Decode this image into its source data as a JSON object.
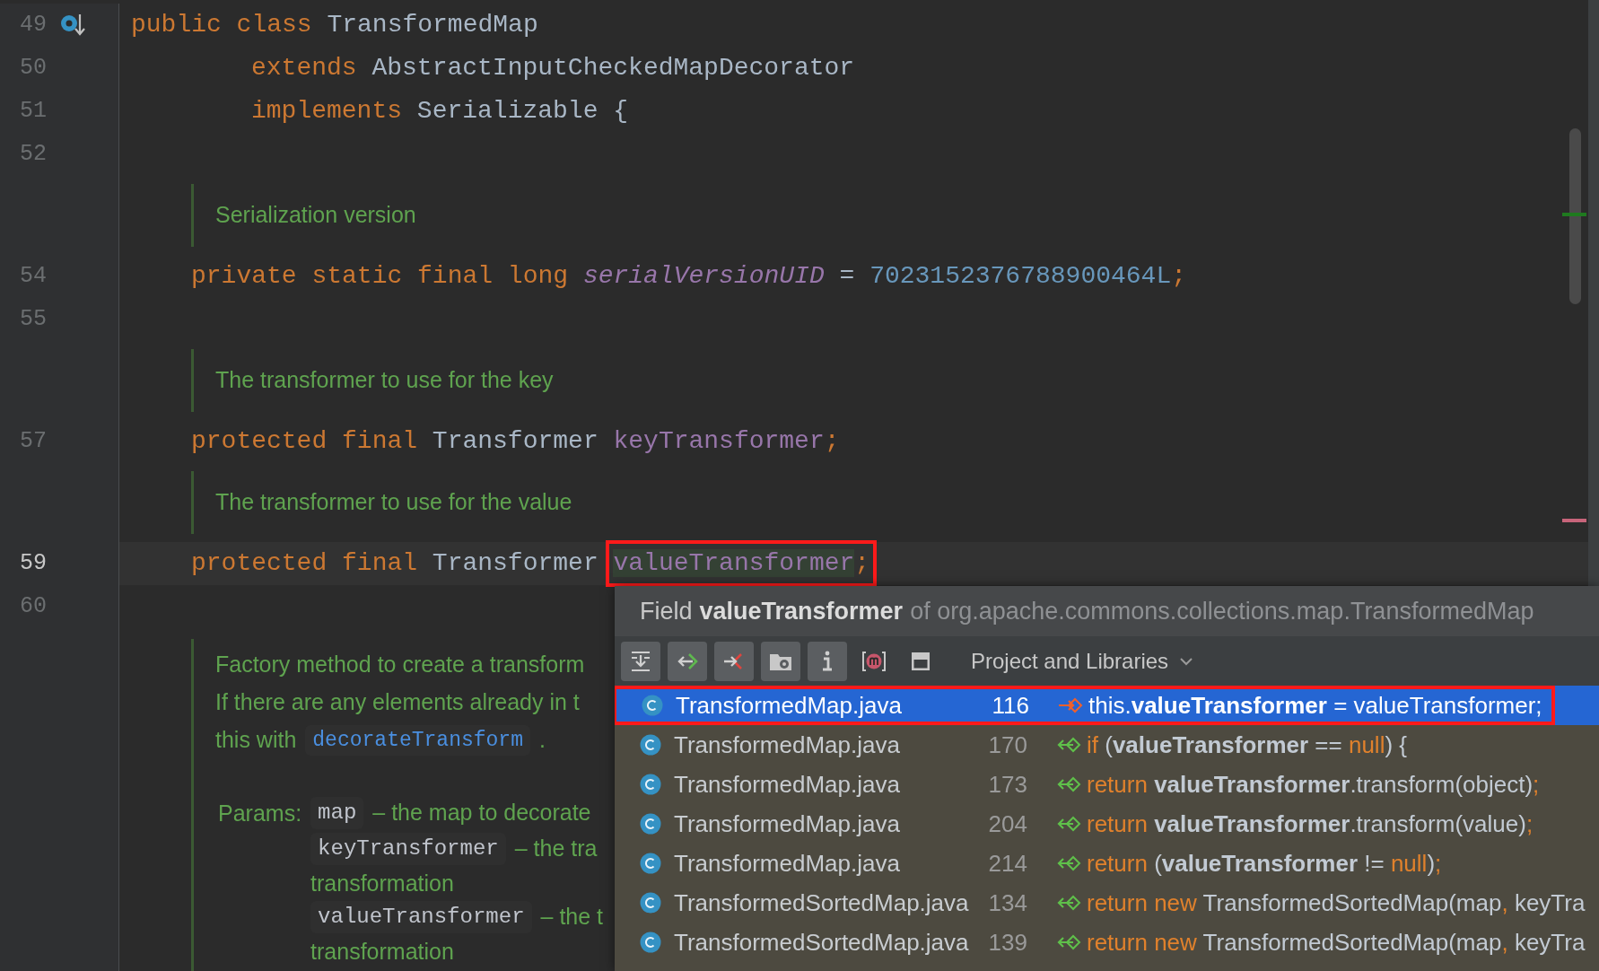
{
  "editor": {
    "lines": [
      {
        "kind": "code",
        "number": "49",
        "current": false,
        "has_implementations": true,
        "tokens": [
          {
            "text": "public class",
            "kind": "keyword"
          },
          {
            "text": " TransformedMap",
            "kind": "plain"
          }
        ]
      },
      {
        "kind": "continuation",
        "number": "50",
        "current": false,
        "tokens": [
          {
            "text": "extends",
            "kind": "keyword"
          },
          {
            "text": " AbstractInputCheckedMapDecorator",
            "kind": "plain"
          }
        ]
      },
      {
        "kind": "continuation",
        "number": "51",
        "current": false,
        "tokens": [
          {
            "text": "implements",
            "kind": "keyword"
          },
          {
            "text": " Serializable {",
            "kind": "plain"
          }
        ]
      },
      {
        "kind": "code",
        "number": "52",
        "current": false
      },
      {
        "kind": "doc",
        "paragraphs": [
          [
            {
              "text": "Serialization version",
              "kind": "text"
            }
          ]
        ]
      },
      {
        "kind": "member",
        "number": "54",
        "current": false,
        "tokens": [
          {
            "text": "private static final long ",
            "kind": "keyword"
          },
          {
            "text": "serialVersionUID",
            "kind": "static_field"
          },
          {
            "text": " = ",
            "kind": "plain"
          },
          {
            "text": "7023152376788900464L",
            "kind": "number"
          },
          {
            "text": ";",
            "kind": "keyword"
          }
        ]
      },
      {
        "kind": "code",
        "number": "55",
        "current": false
      },
      {
        "kind": "doc",
        "paragraphs": [
          [
            {
              "text": "The transformer to use for the key",
              "kind": "text"
            }
          ]
        ]
      },
      {
        "kind": "member",
        "number": "57",
        "current": false,
        "tokens": [
          {
            "text": "protected final",
            "kind": "keyword"
          },
          {
            "text": " Transformer ",
            "kind": "plain"
          },
          {
            "text": "keyTransformer",
            "kind": "field"
          },
          {
            "text": ";",
            "kind": "keyword"
          }
        ]
      },
      {
        "kind": "doc",
        "paragraphs": [
          [
            {
              "text": "The transformer to use for the value",
              "kind": "text"
            }
          ]
        ]
      },
      {
        "kind": "member",
        "number": "59",
        "current": true,
        "tokens": [
          {
            "text": "protected final",
            "kind": "keyword"
          },
          {
            "text": " Transformer ",
            "kind": "plain"
          },
          {
            "text": "valueTransformer",
            "kind": "field",
            "highlighted": true,
            "outlined": true
          },
          {
            "text": ";",
            "kind": "keyword",
            "outlined": true
          }
        ]
      },
      {
        "kind": "code",
        "number": "60",
        "current": false
      },
      {
        "kind": "doc",
        "paragraphs": [
          [
            {
              "text": "Factory method to create a transform",
              "kind": "text"
            }
          ],
          [
            {
              "text": "If there are any elements already in t",
              "kind": "text"
            }
          ],
          [
            {
              "text": "this with",
              "kind": "text"
            },
            {
              "text": "decorateTransform",
              "kind": "link"
            },
            {
              "text": ".",
              "kind": "text"
            }
          ]
        ],
        "params": {
          "label": "Params:",
          "items": [
            {
              "name": "map",
              "description": "– the map to decorate"
            },
            {
              "name": "keyTransformer",
              "description": "– the tra",
              "continuation": "transformation"
            },
            {
              "name": "valueTransformer",
              "description": "– the t",
              "continuation": "transformation"
            }
          ]
        }
      }
    ]
  },
  "usages_popup": {
    "header": {
      "prefix": "Field",
      "name": "valueTransformer",
      "suffix": "of org.apache.commons.collections.map.TransformedMap"
    },
    "toolbar": [
      {
        "kind": "expand",
        "selected": true
      },
      {
        "kind": "read",
        "selected": true
      },
      {
        "kind": "write",
        "selected": true
      },
      {
        "kind": "module",
        "selected": true
      },
      {
        "kind": "info",
        "selected": true
      },
      {
        "kind": "method",
        "selected": false
      },
      {
        "kind": "preview",
        "selected": false
      }
    ],
    "scope": "Project and Libraries",
    "rows": [
      {
        "file": "TransformedMap.java",
        "line": "116",
        "kind": "write",
        "selected": true,
        "outlined": true,
        "code": [
          {
            "text": "this",
            "kind": "keyword"
          },
          {
            "text": ".",
            "kind": "plain"
          },
          {
            "text": "valueTransformer",
            "kind": "bold"
          },
          {
            "text": " = valueTransformer",
            "kind": "plain"
          },
          {
            "text": ";",
            "kind": "keyword"
          }
        ]
      },
      {
        "file": "TransformedMap.java",
        "line": "170",
        "kind": "read",
        "selected": false,
        "code": [
          {
            "text": "if",
            "kind": "keyword"
          },
          {
            "text": " (",
            "kind": "plain"
          },
          {
            "text": "valueTransformer",
            "kind": "bold"
          },
          {
            "text": " == ",
            "kind": "plain"
          },
          {
            "text": "null",
            "kind": "keyword"
          },
          {
            "text": ") {",
            "kind": "plain"
          }
        ]
      },
      {
        "file": "TransformedMap.java",
        "line": "173",
        "kind": "read",
        "selected": false,
        "code": [
          {
            "text": "return ",
            "kind": "keyword"
          },
          {
            "text": "valueTransformer",
            "kind": "bold"
          },
          {
            "text": ".transform(object)",
            "kind": "plain"
          },
          {
            "text": ";",
            "kind": "keyword"
          }
        ]
      },
      {
        "file": "TransformedMap.java",
        "line": "204",
        "kind": "read",
        "selected": false,
        "code": [
          {
            "text": "return ",
            "kind": "keyword"
          },
          {
            "text": "valueTransformer",
            "kind": "bold"
          },
          {
            "text": ".transform(value)",
            "kind": "plain"
          },
          {
            "text": ";",
            "kind": "keyword"
          }
        ]
      },
      {
        "file": "TransformedMap.java",
        "line": "214",
        "kind": "read",
        "selected": false,
        "code": [
          {
            "text": "return",
            "kind": "keyword"
          },
          {
            "text": " (",
            "kind": "plain"
          },
          {
            "text": "valueTransformer",
            "kind": "bold"
          },
          {
            "text": " != ",
            "kind": "plain"
          },
          {
            "text": "null",
            "kind": "keyword"
          },
          {
            "text": ")",
            "kind": "plain"
          },
          {
            "text": ";",
            "kind": "keyword"
          }
        ]
      },
      {
        "file": "TransformedSortedMap.java",
        "line": "134",
        "kind": "read",
        "selected": false,
        "code": [
          {
            "text": "return new",
            "kind": "keyword"
          },
          {
            "text": " TransformedSortedMap(map",
            "kind": "plain"
          },
          {
            "text": ",",
            "kind": "keyword"
          },
          {
            "text": " keyTra",
            "kind": "plain"
          }
        ]
      },
      {
        "file": "TransformedSortedMap.java",
        "line": "139",
        "kind": "read",
        "selected": false,
        "code": [
          {
            "text": "return new",
            "kind": "keyword"
          },
          {
            "text": " TransformedSortedMap(map",
            "kind": "plain"
          },
          {
            "text": ",",
            "kind": "keyword"
          },
          {
            "text": " keyTra",
            "kind": "plain"
          }
        ]
      }
    ]
  }
}
